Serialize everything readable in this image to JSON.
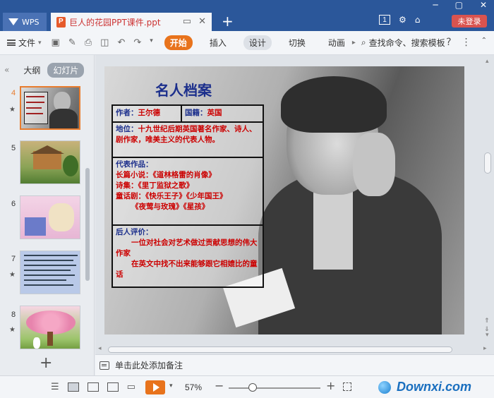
{
  "titlebar": {
    "app_label": "WPS",
    "doc_tab_label": "巨人的花园PPT课件.ppt",
    "badge_number": "1",
    "login_label": "未登录",
    "new_tab": "+",
    "close": "✕"
  },
  "menubar": {
    "file_label": "文件",
    "tabs": [
      "开始",
      "插入",
      "设计",
      "切换",
      "动画"
    ],
    "search_label": "查找命令、搜索模板"
  },
  "left_panel": {
    "outline_tab": "大纲",
    "slides_tab": "幻灯片",
    "slides": [
      {
        "num": "4"
      },
      {
        "num": "5"
      },
      {
        "num": "6"
      },
      {
        "num": "7"
      },
      {
        "num": "8"
      }
    ],
    "add_slide": "+"
  },
  "slide": {
    "title": "名人档案",
    "author_label": "作者：",
    "author": "王尔德",
    "nation_label": "国籍：",
    "nation": "英国",
    "position_label": "地位：",
    "position": "十九世纪后期英国著名作家、诗人、剧作家，唯美主义的代表人物。",
    "works_label": "代表作品：",
    "works": [
      "长篇小说：《道林格雷的肖像》",
      "诗集：《里丁监狱之歌》",
      "童话剧：《快乐王子》《少年国王》",
      "《夜莺与玫瑰》《星孩》"
    ],
    "eval_label": "后人评价：",
    "eval": [
      "一位对社会对艺术做过贡献思想的伟大作家",
      "在英文中找不出来能够跟它相媲比的童话"
    ]
  },
  "notes": {
    "placeholder": "单击此处添加备注"
  },
  "statusbar": {
    "zoom": "57%",
    "watermark": "Downxi.com"
  },
  "colors": {
    "titlebar": "#2b579a",
    "accent_orange": "#e8731c",
    "login_red": "#d9534f",
    "slide_title": "#1c2f8c",
    "slide_red_text": "#cc0000"
  }
}
